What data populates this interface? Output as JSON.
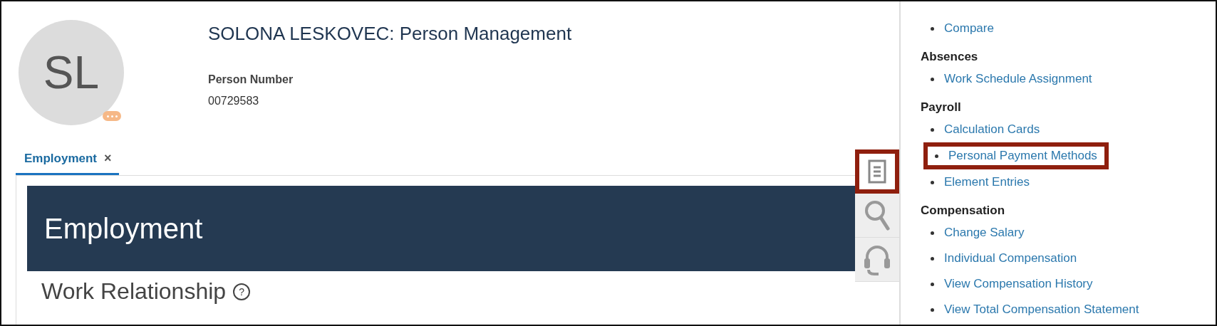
{
  "header": {
    "avatar_initials": "SL",
    "title": "SOLONA LESKOVEC: Person Management",
    "person_number_label": "Person Number",
    "person_number": "00729583"
  },
  "tabs": [
    {
      "label": "Employment",
      "close": "×",
      "selected": true
    }
  ],
  "banner": {
    "title": "Employment"
  },
  "section": {
    "title": "Work Relationship",
    "help": "?"
  },
  "tools": [
    {
      "kind": "document",
      "highlighted": true
    },
    {
      "kind": "search",
      "highlighted": false
    },
    {
      "kind": "headset",
      "highlighted": false
    }
  ],
  "tasks": [
    {
      "links": [
        {
          "label": "Compare",
          "highlighted": false
        }
      ]
    },
    {
      "heading": "Absences",
      "links": [
        {
          "label": "Work Schedule Assignment",
          "highlighted": false
        }
      ]
    },
    {
      "heading": "Payroll",
      "links": [
        {
          "label": "Calculation Cards",
          "highlighted": false
        },
        {
          "label": "Personal Payment Methods",
          "highlighted": true
        },
        {
          "label": "Element Entries",
          "highlighted": false
        }
      ]
    },
    {
      "heading": "Compensation",
      "links": [
        {
          "label": "Change Salary",
          "highlighted": false
        },
        {
          "label": "Individual Compensation",
          "highlighted": false
        },
        {
          "label": "View Compensation History",
          "highlighted": false
        },
        {
          "label": "View Total Compensation Statement",
          "highlighted": false
        }
      ]
    }
  ]
}
